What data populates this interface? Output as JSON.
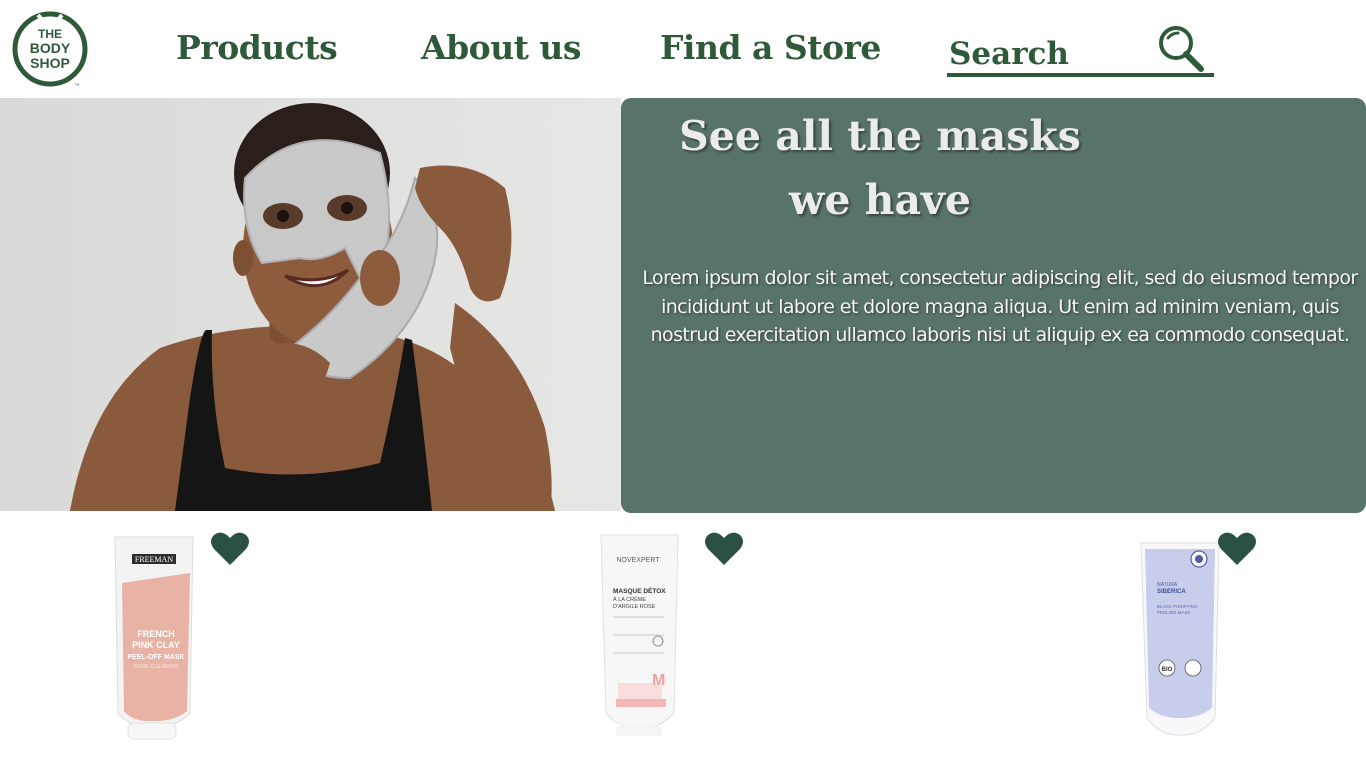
{
  "brand": {
    "logo_text_line1": "THE",
    "logo_text_line2": "BODY",
    "logo_text_line3": "SHOP",
    "logo_tm": "™",
    "color_primary": "#2f5a3a",
    "color_panel": "#58736a"
  },
  "nav": {
    "products": "Products",
    "about": "About us",
    "store": "Find a Store"
  },
  "search": {
    "placeholder": "Search",
    "icon": "search-icon"
  },
  "hero": {
    "title": "See all the masks we have",
    "text": "Lorem ipsum dolor sit amet, consectetur adipiscing elit, sed do eiusmod tempor incididunt ut labore et dolore magna aliqua. Ut enim ad minim veniam, quis nostrud exercitation ullamco laboris nisi ut aliquip ex ea commodo consequat."
  },
  "products": [
    {
      "brand": "FREEMAN",
      "line1": "FRENCH",
      "line2": "PINK CLAY",
      "line3": "PEEL-OFF MASK",
      "line4": "PORE CLEARING",
      "favorite_icon": "heart-icon"
    },
    {
      "brand": "NOVEXPERT",
      "line1": "MASQUE DÉTOX",
      "line2": "À LA CRÈME",
      "line3": "D'ARGILE ROSE",
      "favorite_icon": "heart-icon"
    },
    {
      "brand": "NATURA",
      "line1": "SIBERICA",
      "line2": "BLACK PURIFYING",
      "line3": "PEELING MASK",
      "badge": "BIO",
      "favorite_icon": "heart-icon"
    }
  ]
}
